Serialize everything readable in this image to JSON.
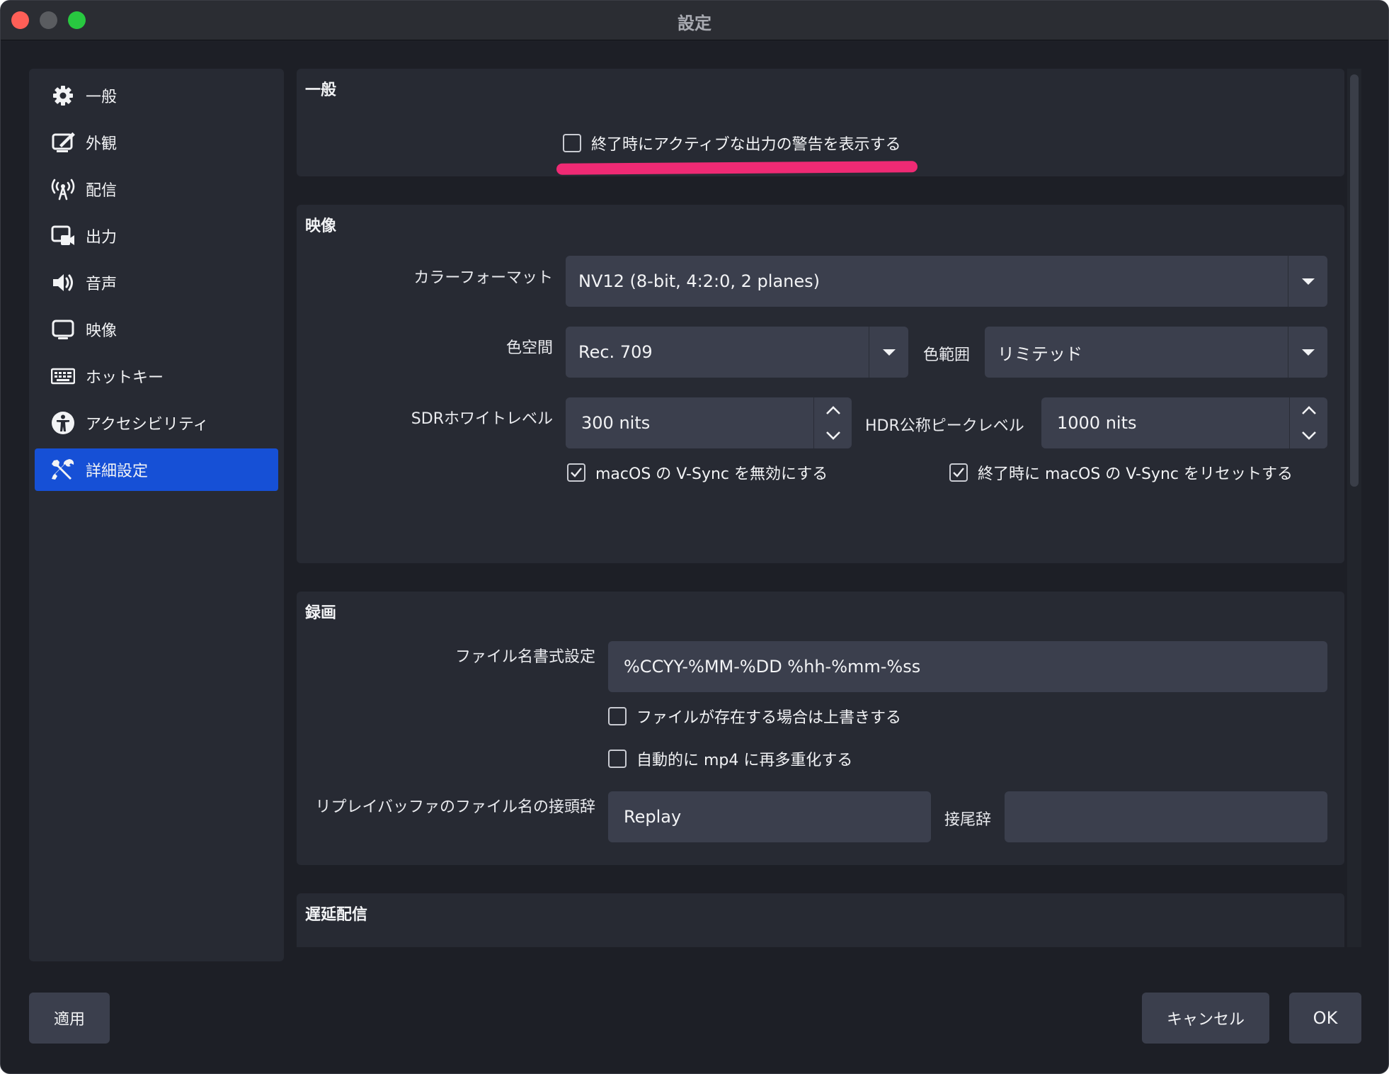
{
  "window": {
    "title": "設定"
  },
  "sidebar": {
    "items": [
      {
        "label": "一般",
        "icon": "gear-icon"
      },
      {
        "label": "外観",
        "icon": "appearance-icon"
      },
      {
        "label": "配信",
        "icon": "antenna-icon"
      },
      {
        "label": "出力",
        "icon": "output-icon"
      },
      {
        "label": "音声",
        "icon": "speaker-icon"
      },
      {
        "label": "映像",
        "icon": "monitor-icon"
      },
      {
        "label": "ホットキー",
        "icon": "keyboard-icon"
      },
      {
        "label": "アクセシビリティ",
        "icon": "accessibility-icon"
      },
      {
        "label": "詳細設定",
        "icon": "tools-icon",
        "active": true
      }
    ]
  },
  "general": {
    "title": "一般",
    "warn_on_exit_label": "終了時にアクティブな出力の警告を表示する",
    "warn_on_exit_checked": false
  },
  "video": {
    "title": "映像",
    "color_format_label": "カラーフォーマット",
    "color_format_value": "NV12 (8-bit, 4:2:0, 2 planes)",
    "color_space_label": "色空間",
    "color_space_value": "Rec. 709",
    "color_range_label": "色範囲",
    "color_range_value": "リミテッド",
    "sdr_white_label": "SDRホワイトレベル",
    "sdr_white_value": "300 nits",
    "hdr_peak_label": "HDR公称ピークレベル",
    "hdr_peak_value": "1000 nits",
    "disable_vsync_label": "macOS の V-Sync を無効にする",
    "disable_vsync_checked": true,
    "reset_vsync_label": "終了時に macOS の V-Sync をリセットする",
    "reset_vsync_checked": true
  },
  "recording": {
    "title": "録画",
    "filename_format_label": "ファイル名書式設定",
    "filename_format_value": "%CCYY-%MM-%DD %hh-%mm-%ss",
    "overwrite_label": "ファイルが存在する場合は上書きする",
    "overwrite_checked": false,
    "auto_remux_label": "自動的に mp4 に再多重化する",
    "auto_remux_checked": false,
    "replay_prefix_label": "リプレイバッファのファイル名の接頭辞",
    "replay_prefix_value": "Replay",
    "replay_suffix_label": "接尾辞",
    "replay_suffix_value": ""
  },
  "delay": {
    "title": "遅延配信"
  },
  "footer": {
    "apply_label": "適用",
    "cancel_label": "キャンセル",
    "ok_label": "OK"
  },
  "colors": {
    "window_bg": "#1d1f26",
    "panel_bg": "#272a33",
    "field_bg": "#3b3f4d",
    "accent": "#1650d6",
    "annotation": "#ef2a74"
  }
}
